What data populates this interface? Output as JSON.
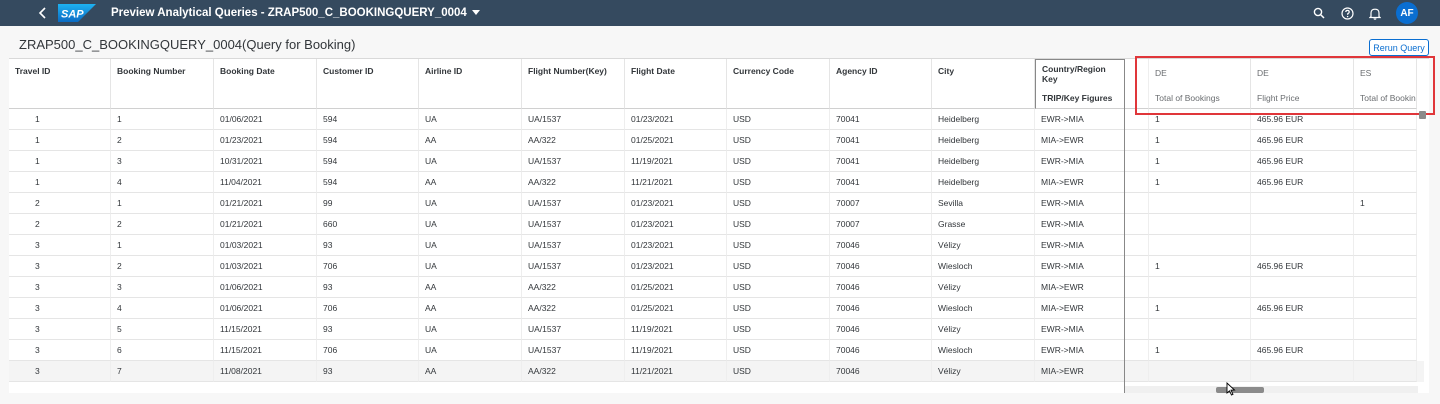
{
  "shell": {
    "app_title": "Preview Analytical Queries - ZRAP500_C_BOOKINGQUERY_0004",
    "avatar_initials": "AF",
    "brand_color": "#354a5f",
    "logo_text": "SAP"
  },
  "page": {
    "title": "ZRAP500_C_BOOKINGQUERY_0004(Query for Booking)",
    "rerun_label": "Rerun Query"
  },
  "grid": {
    "columns": [
      "Travel ID",
      "Booking Number",
      "Booking Date",
      "Customer ID",
      "Airline ID",
      "Flight Number(Key)",
      "Flight Date",
      "Currency Code",
      "Agency ID",
      "City"
    ],
    "country_header": "Country/Region Key",
    "trip_header": "TRIP/Key Figures",
    "pivot_country": [
      "DE",
      "DE",
      "ES"
    ],
    "pivot_measures": [
      "Total of Bookings",
      "Flight Price",
      "Total of Bookin"
    ],
    "rows": [
      {
        "cells": [
          "1",
          "1",
          "01/06/2021",
          "594",
          "UA",
          "UA/1537",
          "01/23/2021",
          "USD",
          "70041",
          "Heidelberg"
        ],
        "trip": "EWR->MIA",
        "p1": "1",
        "p2": "465.96 EUR",
        "p3": ""
      },
      {
        "cells": [
          "1",
          "2",
          "01/23/2021",
          "594",
          "AA",
          "AA/322",
          "01/25/2021",
          "USD",
          "70041",
          "Heidelberg"
        ],
        "trip": "MIA->EWR",
        "p1": "1",
        "p2": "465.96 EUR",
        "p3": ""
      },
      {
        "cells": [
          "1",
          "3",
          "10/31/2021",
          "594",
          "UA",
          "UA/1537",
          "11/19/2021",
          "USD",
          "70041",
          "Heidelberg"
        ],
        "trip": "EWR->MIA",
        "p1": "1",
        "p2": "465.96 EUR",
        "p3": ""
      },
      {
        "cells": [
          "1",
          "4",
          "11/04/2021",
          "594",
          "AA",
          "AA/322",
          "11/21/2021",
          "USD",
          "70041",
          "Heidelberg"
        ],
        "trip": "MIA->EWR",
        "p1": "1",
        "p2": "465.96 EUR",
        "p3": ""
      },
      {
        "cells": [
          "2",
          "1",
          "01/21/2021",
          "99",
          "UA",
          "UA/1537",
          "01/23/2021",
          "USD",
          "70007",
          "Sevilla"
        ],
        "trip": "EWR->MIA",
        "p1": "",
        "p2": "",
        "p3": "1"
      },
      {
        "cells": [
          "2",
          "2",
          "01/21/2021",
          "660",
          "UA",
          "UA/1537",
          "01/23/2021",
          "USD",
          "70007",
          "Grasse"
        ],
        "trip": "EWR->MIA",
        "p1": "",
        "p2": "",
        "p3": ""
      },
      {
        "cells": [
          "3",
          "1",
          "01/03/2021",
          "93",
          "UA",
          "UA/1537",
          "01/23/2021",
          "USD",
          "70046",
          "Vélizy"
        ],
        "trip": "EWR->MIA",
        "p1": "",
        "p2": "",
        "p3": ""
      },
      {
        "cells": [
          "3",
          "2",
          "01/03/2021",
          "706",
          "UA",
          "UA/1537",
          "01/23/2021",
          "USD",
          "70046",
          "Wiesloch"
        ],
        "trip": "EWR->MIA",
        "p1": "1",
        "p2": "465.96 EUR",
        "p3": ""
      },
      {
        "cells": [
          "3",
          "3",
          "01/06/2021",
          "93",
          "AA",
          "AA/322",
          "01/25/2021",
          "USD",
          "70046",
          "Vélizy"
        ],
        "trip": "MIA->EWR",
        "p1": "",
        "p2": "",
        "p3": ""
      },
      {
        "cells": [
          "3",
          "4",
          "01/06/2021",
          "706",
          "AA",
          "AA/322",
          "01/25/2021",
          "USD",
          "70046",
          "Wiesloch"
        ],
        "trip": "MIA->EWR",
        "p1": "1",
        "p2": "465.96 EUR",
        "p3": ""
      },
      {
        "cells": [
          "3",
          "5",
          "11/15/2021",
          "93",
          "UA",
          "UA/1537",
          "11/19/2021",
          "USD",
          "70046",
          "Vélizy"
        ],
        "trip": "EWR->MIA",
        "p1": "",
        "p2": "",
        "p3": ""
      },
      {
        "cells": [
          "3",
          "6",
          "11/15/2021",
          "706",
          "UA",
          "UA/1537",
          "11/19/2021",
          "USD",
          "70046",
          "Wiesloch"
        ],
        "trip": "EWR->MIA",
        "p1": "1",
        "p2": "465.96 EUR",
        "p3": ""
      },
      {
        "cells": [
          "3",
          "7",
          "11/08/2021",
          "93",
          "AA",
          "AA/322",
          "11/21/2021",
          "USD",
          "70046",
          "Vélizy"
        ],
        "trip": "MIA->EWR",
        "p1": "",
        "p2": "",
        "p3": ""
      }
    ]
  },
  "icons": [
    "back-icon",
    "sap-logo",
    "dropdown-caret-icon",
    "search-icon",
    "help-icon",
    "notifications-icon",
    "user-avatar"
  ]
}
